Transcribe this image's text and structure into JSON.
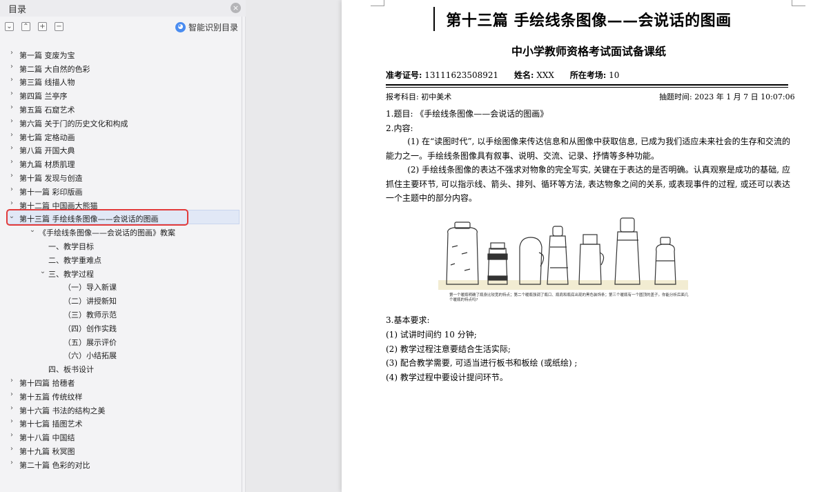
{
  "toc": {
    "title": "目录",
    "smart_label": "智能识别目录",
    "items": [
      {
        "label": "第一篇  变废为宝"
      },
      {
        "label": "第二篇  大自然的色彩"
      },
      {
        "label": "第三篇  线描人物"
      },
      {
        "label": "第四篇  兰亭序"
      },
      {
        "label": "第五篇  石窟艺术"
      },
      {
        "label": "第六篇  关于门的历史文化和构成"
      },
      {
        "label": "第七篇  定格动画"
      },
      {
        "label": "第八篇  开国大典"
      },
      {
        "label": "第九篇  材质肌理"
      },
      {
        "label": "第十篇  发现与创造"
      },
      {
        "label": "第十一篇  彩印版画"
      },
      {
        "label": "第十二篇  中国画大熊猫"
      },
      {
        "label": "第十三篇  手绘线条图像——会说话的图画"
      },
      {
        "label": "《手绘线条图像——会说话的图画》教案"
      },
      {
        "label": "一、教学目标"
      },
      {
        "label": "二、教学重难点"
      },
      {
        "label": "三、教学过程"
      },
      {
        "label": "（一）导入新课"
      },
      {
        "label": "（二）讲授新知"
      },
      {
        "label": "（三）教师示范"
      },
      {
        "label": "（四）创作实践"
      },
      {
        "label": "（五）展示评价"
      },
      {
        "label": "（六）小结拓展"
      },
      {
        "label": "四、板书设计"
      },
      {
        "label": "第十四篇  拾穗者"
      },
      {
        "label": "第十五篇  传统纹样"
      },
      {
        "label": "第十六篇  书法的结构之美"
      },
      {
        "label": "第十七篇  插图艺术"
      },
      {
        "label": "第十八篇  中国结"
      },
      {
        "label": "第十九篇  秋冥图"
      },
      {
        "label": "第二十篇  色彩的对比"
      }
    ]
  },
  "doc": {
    "title": "第十三篇  手绘线条图像——会说话的图画",
    "subtitle": "中小学教师资格考试面试备课纸",
    "exam_no_label": "准考证号:",
    "exam_no": "13111623508921",
    "name_label": "姓名:",
    "name": "XXX",
    "venue_label": "所在考场:",
    "venue": "10",
    "subject": "报考科目: 初中美术",
    "draw_time": "抽题时间: 2023 年 1 月 7 日 10:07:06",
    "q_title": "1.题目: 《手绘线条图像——会说话的图画》",
    "content_label": "2.内容:",
    "para1": "(1) 在“读图时代”, 以手绘图像来传达信息和从图像中获取信息, 已成为我们适应未来社会的生存和交流的能力之一。手绘线条图像具有叙事、说明、交流、记录、抒情等多种功能。",
    "para2": "(2) 手绘线条图像的表达不强求对物象的完全写实, 关键在于表达的是否明确。认真观察是成功的基础, 应抓住主要环节, 可以指示线、箭头、排列、循环等方法, 表达物象之间的关系, 或表现事件的过程, 或还可以表达一个主题中的部分内容。",
    "illustration_caption": "第一个暖瓶明确了瓶身比较宽的特点；第二个暖瓶强调了瓶口、瓶肩和瓶底出现的黑色装饰条；第三个暖瓶有一个圆顶的盖子。你能分析后面几个暖瓶的特点吗?",
    "req_title": "3.基本要求:",
    "req1": "(1) 试讲时间约 10 分钟;",
    "req2": "(2) 教学过程注意要结合生活实际;",
    "req3": "(3) 配合教学需要, 可适当进行板书和板绘 (或纸绘) ;",
    "req4": "(4) 教学过程中要设计提问环节。"
  }
}
